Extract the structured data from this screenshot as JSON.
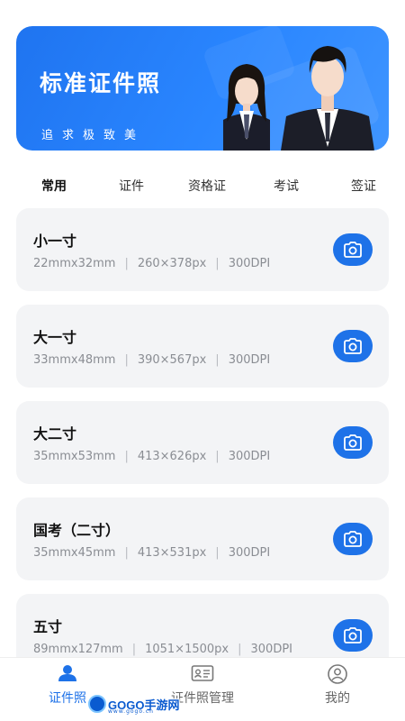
{
  "banner": {
    "title": "标准证件照",
    "subtitle": "追求极致美"
  },
  "tabs": [
    {
      "label": "常用",
      "active": true
    },
    {
      "label": "证件",
      "active": false
    },
    {
      "label": "资格证",
      "active": false
    },
    {
      "label": "考试",
      "active": false
    },
    {
      "label": "签证",
      "active": false
    }
  ],
  "cards": [
    {
      "title": "小一寸",
      "size": "22mmx32mm",
      "pixels": "260×378px",
      "dpi": "300DPI"
    },
    {
      "title": "大一寸",
      "size": "33mmx48mm",
      "pixels": "390×567px",
      "dpi": "300DPI"
    },
    {
      "title": "大二寸",
      "size": "35mmx53mm",
      "pixels": "413×626px",
      "dpi": "300DPI"
    },
    {
      "title": "国考（二寸）",
      "size": "35mmx45mm",
      "pixels": "413×531px",
      "dpi": "300DPI"
    },
    {
      "title": "五寸",
      "size": "89mmx127mm",
      "pixels": "1051×1500px",
      "dpi": "300DPI"
    }
  ],
  "bottom_nav": [
    {
      "label": "证件照",
      "icon": "person-icon",
      "active": true
    },
    {
      "label": "证件照管理",
      "icon": "id-card-icon",
      "active": false
    },
    {
      "label": "我的",
      "icon": "profile-icon",
      "active": false
    }
  ],
  "watermark": {
    "text": "GOGO手游网",
    "small": "www.gogo.cn"
  },
  "colors": {
    "accent": "#1e72e8",
    "card_bg": "#f3f4f6"
  }
}
